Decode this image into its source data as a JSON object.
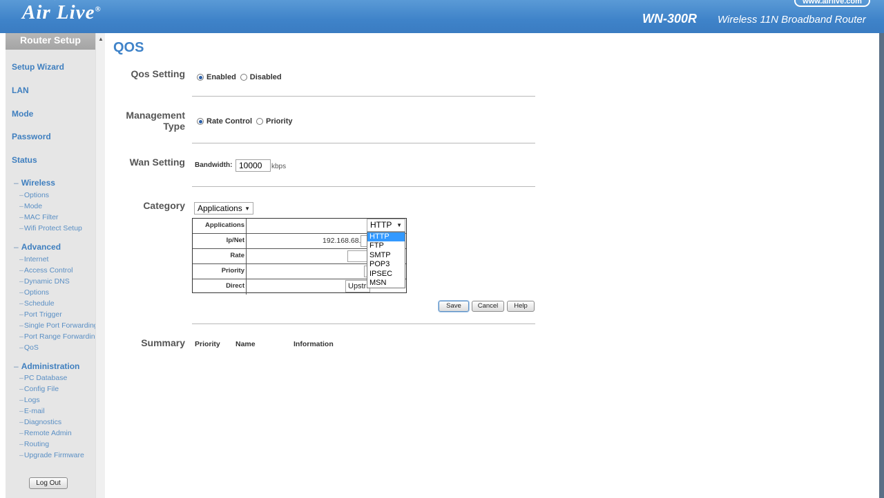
{
  "header": {
    "logo": "Air Live",
    "logo_mark": "®",
    "url": "www.airlive.com",
    "model": "WN-300R",
    "product": "Wireless 11N Broadband Router"
  },
  "sidebar": {
    "title": "Router Setup",
    "main_items": [
      "Setup Wizard",
      "LAN",
      "Mode",
      "Password",
      "Status"
    ],
    "wireless": {
      "label": "Wireless",
      "items": [
        "Options",
        "Mode",
        "MAC Filter",
        "Wifi Protect Setup"
      ]
    },
    "advanced": {
      "label": "Advanced",
      "items": [
        "Internet",
        "Access Control",
        "Dynamic DNS",
        "Options",
        "Schedule",
        "Port Trigger",
        "Single Port Forwarding",
        "Port Range Forwarding",
        "QoS"
      ]
    },
    "administration": {
      "label": "Administration",
      "items": [
        "PC Database",
        "Config File",
        "Logs",
        "E-mail",
        "Diagnostics",
        "Remote Admin",
        "Routing",
        "Upgrade Firmware"
      ]
    },
    "logout": "Log Out"
  },
  "main": {
    "title": "QOS",
    "qos_setting": {
      "label": "Qos Setting",
      "enabled": "Enabled",
      "disabled": "Disabled",
      "selected": "Enabled"
    },
    "management_type": {
      "label_line1": "Management",
      "label_line2": "Type",
      "rate_control": "Rate Control",
      "priority": "Priority",
      "selected": "Rate Control"
    },
    "wan_setting": {
      "label": "Wan Setting",
      "bandwidth_label": "Bandwidth:",
      "bandwidth_value": "10000",
      "unit": "kbps"
    },
    "category": {
      "label": "Category",
      "selected": "Applications",
      "table": {
        "applications_label": "Applications",
        "applications_value": "HTTP",
        "ipnet_label": "Ip/Net",
        "ipnet_value": "192.168.68.",
        "rate_label": "Rate",
        "priority_label": "Priority",
        "direct_label": "Direct",
        "direct_value": "Upstr"
      },
      "dropdown_options": [
        "HTTP",
        "FTP",
        "SMTP",
        "POP3",
        "IPSEC",
        "MSN"
      ],
      "dropdown_selected": "HTTP"
    },
    "buttons": {
      "save": "Save",
      "cancel": "Cancel",
      "help": "Help"
    },
    "summary": {
      "label": "Summary",
      "columns": [
        "Priority",
        "Name",
        "Information"
      ]
    }
  }
}
